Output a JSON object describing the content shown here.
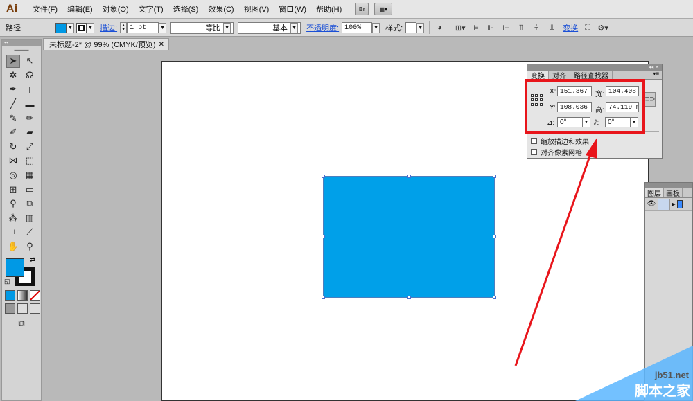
{
  "menubar": {
    "logo": "Ai",
    "items": [
      "文件(F)",
      "编辑(E)",
      "对象(O)",
      "文字(T)",
      "选择(S)",
      "效果(C)",
      "视图(V)",
      "窗口(W)",
      "帮助(H)"
    ],
    "bridge_label": "Br"
  },
  "controlbar": {
    "selection_label": "路径",
    "stroke_link": "描边:",
    "stroke_weight": "1 pt",
    "profile_label": "等比",
    "brush_label": "基本",
    "opacity_link": "不透明度:",
    "opacity_value": "100%",
    "style_label": "样式:",
    "transform_link": "变换",
    "fill_color": "#0099e5"
  },
  "document": {
    "tab_title": "未标题-2* @ 99% (CMYK/预览)",
    "shape_color": "#00a0e9"
  },
  "transform_panel": {
    "tabs": [
      "变换",
      "对齐",
      "路径查找器"
    ],
    "x_label": "X:",
    "x_value": "151.367",
    "w_label": "宽:",
    "w_value": "104.408",
    "y_label": "Y:",
    "y_value": "108.036",
    "h_label": "高:",
    "h_value": "74.119 m",
    "rotate_value": "0°",
    "shear_value": "0°",
    "scale_strokes_label": "缩放描边和效果",
    "align_pixel_label": "对齐像素网格",
    "highlight_color": "#e8151b"
  },
  "layers_panel": {
    "tabs": [
      "图层",
      "画板"
    ]
  },
  "watermark": {
    "site": "jb51.net",
    "brand": "脚本之家"
  }
}
